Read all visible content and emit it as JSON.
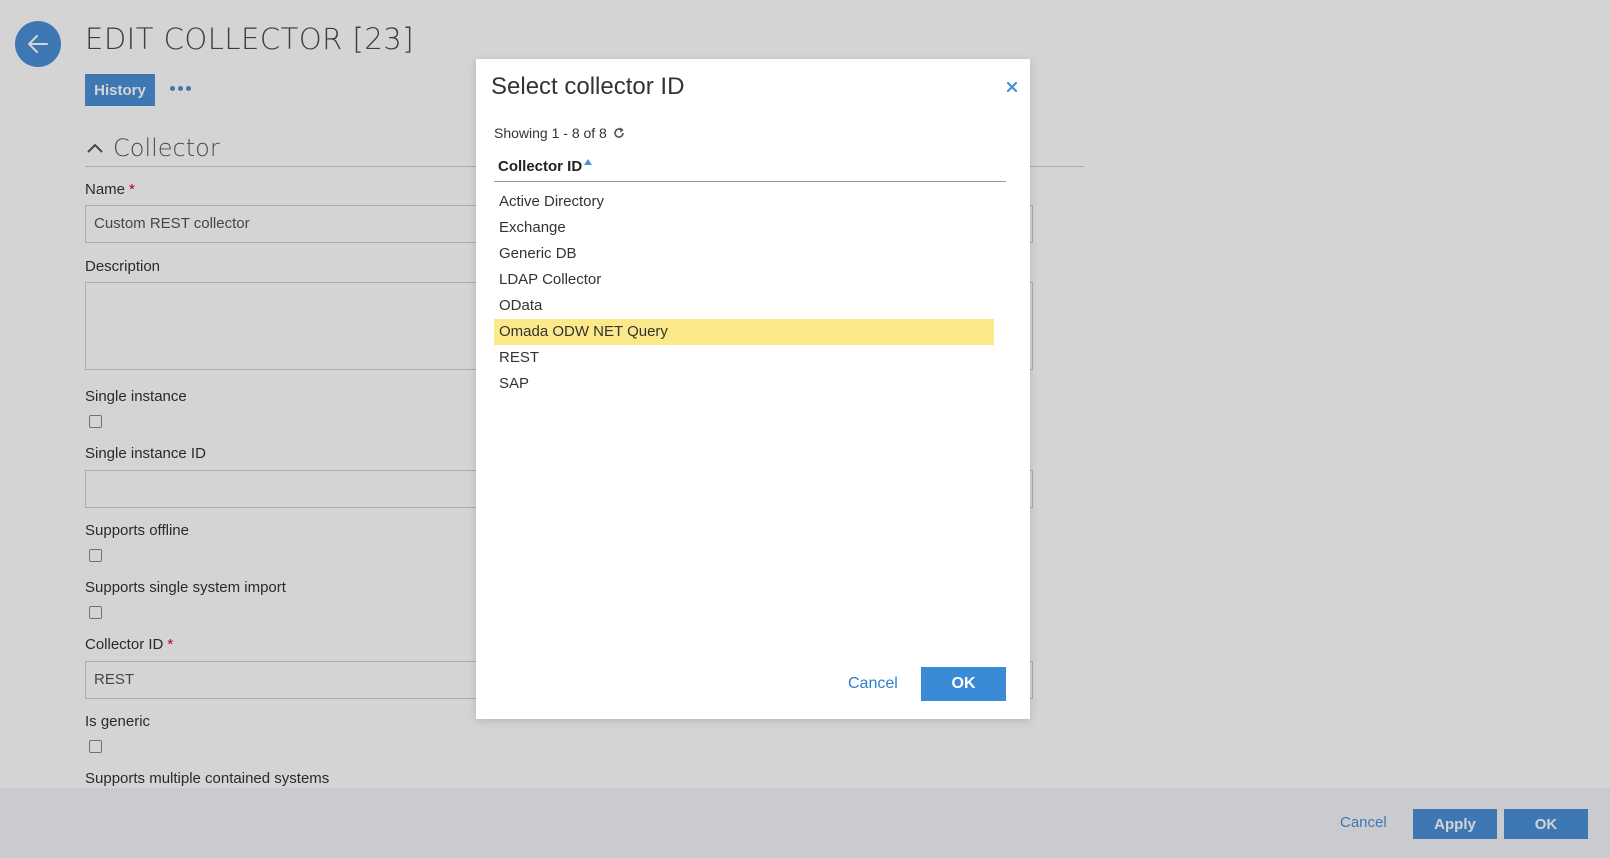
{
  "page": {
    "title": "EDIT COLLECTOR [23]",
    "history_label": "History",
    "section_title": "Collector"
  },
  "form": {
    "name_label": "Name",
    "required_marker": "*",
    "name_value": "Custom REST collector",
    "description_label": "Description",
    "single_instance_label": "Single instance",
    "single_instance_id_label": "Single instance ID",
    "supports_offline_label": "Supports offline",
    "supports_single_system_import_label": "Supports single system import",
    "collector_id_label": "Collector ID",
    "collector_id_value": "REST",
    "is_generic_label": "Is generic",
    "supports_multiple_contained_systems_label": "Supports multiple contained systems"
  },
  "footer": {
    "cancel_label": "Cancel",
    "apply_label": "Apply",
    "ok_label": "OK"
  },
  "modal": {
    "title": "Select collector ID",
    "showing": "Showing 1 - 8 of 8",
    "column_header": "Collector ID",
    "items": [
      {
        "label": "Active Directory"
      },
      {
        "label": "Exchange"
      },
      {
        "label": "Generic DB"
      },
      {
        "label": "LDAP Collector"
      },
      {
        "label": "OData"
      },
      {
        "label": "Omada ODW NET Query"
      },
      {
        "label": "REST"
      },
      {
        "label": "SAP"
      }
    ],
    "selected_index": 5,
    "cancel_label": "Cancel",
    "ok_label": "OK"
  },
  "colors": {
    "accent": "#4a90d9",
    "selected_row": "#fbe98a",
    "required": "#d0021b"
  },
  "icons": [
    "back-arrow-icon",
    "more-dots-icon",
    "chevron-up-icon",
    "close-icon",
    "refresh-icon",
    "sort-ascending-icon"
  ]
}
